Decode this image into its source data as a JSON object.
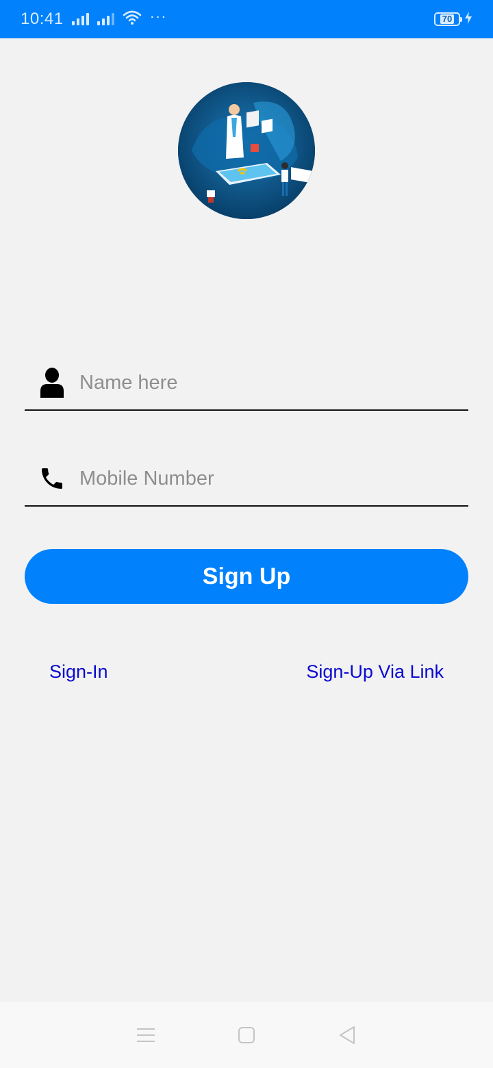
{
  "status_bar": {
    "time": "10:41",
    "battery": "70",
    "more": "···"
  },
  "form": {
    "name_placeholder": "Name here",
    "mobile_placeholder": "Mobile Number",
    "signup_label": "Sign Up"
  },
  "links": {
    "signin": "Sign-In",
    "signup_via_link": "Sign-Up Via Link"
  },
  "colors": {
    "accent": "#0181fc",
    "link": "#0a0ad0",
    "background": "#f2f2f2"
  },
  "icons": {
    "name_field": "person-icon",
    "mobile_field": "phone-icon",
    "nav": [
      "menu-icon",
      "home-square-icon",
      "back-triangle-icon"
    ]
  }
}
